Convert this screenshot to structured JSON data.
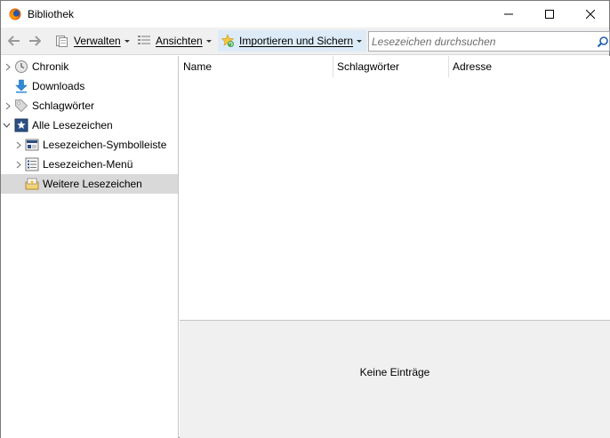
{
  "window": {
    "title": "Bibliothek"
  },
  "toolbar": {
    "organize_label": "Verwalten",
    "views_label": "Ansichten",
    "import_label": "Importieren und Sichern",
    "search_placeholder": "Lesezeichen durchsuchen"
  },
  "sidebar": {
    "items": [
      {
        "label": "Chronik",
        "icon": "history-clock-icon",
        "expandable": true,
        "expanded": false
      },
      {
        "label": "Downloads",
        "icon": "download-arrow-icon",
        "expandable": false
      },
      {
        "label": "Schlagwörter",
        "icon": "tag-icon",
        "expandable": true,
        "expanded": false
      },
      {
        "label": "Alle Lesezeichen",
        "icon": "bookmarks-star-icon",
        "expandable": true,
        "expanded": true
      },
      {
        "label": "Lesezeichen-Symbolleiste",
        "icon": "bookmarks-toolbar-icon",
        "expandable": true,
        "expanded": false
      },
      {
        "label": "Lesezeichen-Menü",
        "icon": "bookmarks-menu-icon",
        "expandable": true,
        "expanded": false
      },
      {
        "label": "Weitere Lesezeichen",
        "icon": "unsorted-folder-icon",
        "expandable": false,
        "selected": true
      }
    ]
  },
  "table": {
    "columns": [
      "Name",
      "Schlagwörter",
      "Adresse"
    ],
    "rows": []
  },
  "details": {
    "empty_text": "Keine Einträge"
  },
  "colors": {
    "toolbar_bg": "#f0f0f0",
    "import_highlight": "#dcebf7",
    "selection": "#d9d9d9"
  }
}
